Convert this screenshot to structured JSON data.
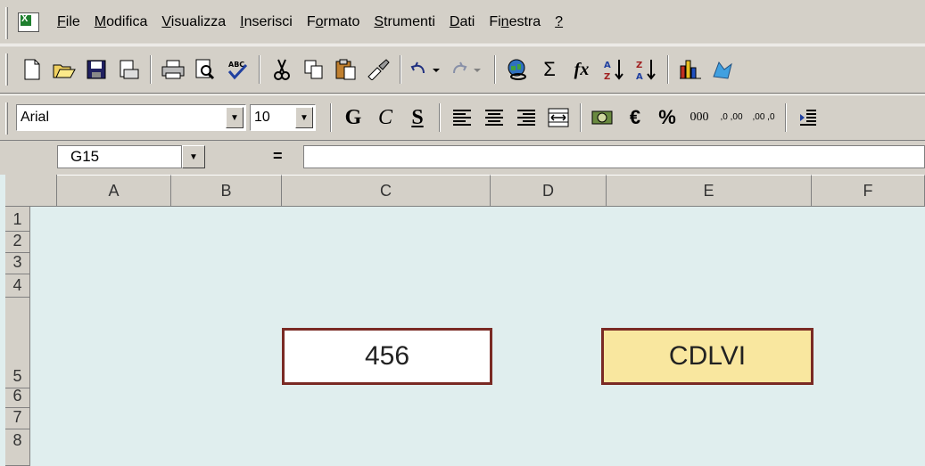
{
  "menu": {
    "items": [
      {
        "pre": "",
        "u": "F",
        "post": "ile"
      },
      {
        "pre": "",
        "u": "M",
        "post": "odifica"
      },
      {
        "pre": "",
        "u": "V",
        "post": "isualizza"
      },
      {
        "pre": "",
        "u": "I",
        "post": "nserisci"
      },
      {
        "pre": "F",
        "u": "o",
        "post": "rmato"
      },
      {
        "pre": "",
        "u": "S",
        "post": "trumenti"
      },
      {
        "pre": "",
        "u": "D",
        "post": "ati"
      },
      {
        "pre": "Fi",
        "u": "n",
        "post": "estra"
      },
      {
        "pre": "",
        "u": "?",
        "post": ""
      }
    ]
  },
  "standard_toolbar": {
    "icons": [
      "new-icon",
      "open-icon",
      "save-icon",
      "email-icon",
      "print-icon",
      "print-preview-icon",
      "spelling-icon",
      "cut-icon",
      "copy-icon",
      "paste-icon",
      "format-painter-icon",
      "undo-icon",
      "redo-icon",
      "hyperlink-icon",
      "autosum-icon",
      "function-icon",
      "sort-ascending-icon",
      "sort-descending-icon",
      "chart-wizard-icon",
      "drawing-icon"
    ],
    "glyphs": {
      "sigma": "Σ",
      "fx": "fx"
    }
  },
  "format_toolbar": {
    "font_name": "Arial",
    "font_size": "10",
    "bold": "G",
    "italic": "C",
    "underline": "S",
    "euro": "€",
    "percent": "%",
    "thousands": "000",
    "inc_decimal": ",0 ,00",
    "dec_decimal": ",00 ,0"
  },
  "formula_bar": {
    "name_box": "G15",
    "equals": "=",
    "formula": ""
  },
  "columns": [
    "A",
    "B",
    "C",
    "D",
    "E",
    "F"
  ],
  "rows": [
    "1",
    "2",
    "3",
    "4",
    "5",
    "6",
    "7",
    "8"
  ],
  "cells": {
    "arabic_value": "456",
    "roman_value": "CDLVI"
  }
}
